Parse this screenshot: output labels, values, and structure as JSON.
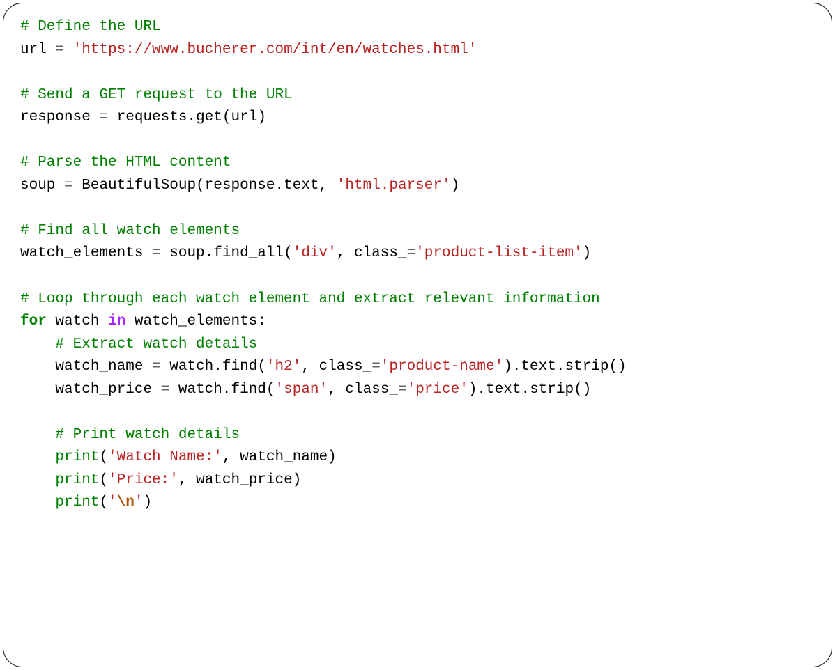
{
  "code": {
    "c1": "# Define the URL",
    "l2_var": "url",
    "l2_eq": " = ",
    "l2_str": "'https://www.bucherer.com/int/en/watches.html'",
    "c3": "# Send a GET request to the URL",
    "l4_var": "response",
    "l4_eq": " = ",
    "l4_call": "requests",
    "l4_dot": ".",
    "l4_get": "get",
    "l4_op": "(",
    "l4_arg": "url",
    "l4_cl": ")",
    "c5": "# Parse the HTML content",
    "l6_var": "soup",
    "l6_eq": " = ",
    "l6_bs": "BeautifulSoup",
    "l6_op": "(",
    "l6_resp": "response",
    "l6_dot": ".",
    "l6_text": "text",
    "l6_comma": ", ",
    "l6_str": "'html.parser'",
    "l6_cl": ")",
    "c7": "# Find all watch elements",
    "l8_var": "watch_elements",
    "l8_eq": " = ",
    "l8_soup": "soup",
    "l8_dot": ".",
    "l8_find": "find_all",
    "l8_op": "(",
    "l8_str1": "'div'",
    "l8_comma": ", ",
    "l8_class": "class_",
    "l8_eq2": "=",
    "l8_str2": "'product-list-item'",
    "l8_cl": ")",
    "c9": "# Loop through each watch element and extract relevant information",
    "l10_for": "for",
    "l10_sp1": " ",
    "l10_watch": "watch",
    "l10_sp2": " ",
    "l10_in": "in",
    "l10_sp3": " ",
    "l10_we": "watch_elements",
    "l10_colon": ":",
    "l11_indent": "    ",
    "c11": "# Extract watch details",
    "l12_indent": "    ",
    "l12_var": "watch_name",
    "l12_eq": " = ",
    "l12_watch": "watch",
    "l12_dot": ".",
    "l12_find": "find",
    "l12_op": "(",
    "l12_str1": "'h2'",
    "l12_comma": ", ",
    "l12_class": "class_",
    "l12_eq2": "=",
    "l12_str2": "'product-name'",
    "l12_cl": ")",
    "l12_dot2": ".",
    "l12_text": "text",
    "l12_dot3": ".",
    "l12_strip": "strip",
    "l12_op2": "(",
    "l12_cl2": ")",
    "l13_indent": "    ",
    "l13_var": "watch_price",
    "l13_eq": " = ",
    "l13_watch": "watch",
    "l13_dot": ".",
    "l13_find": "find",
    "l13_op": "(",
    "l13_str1": "'span'",
    "l13_comma": ", ",
    "l13_class": "class_",
    "l13_eq2": "=",
    "l13_str2": "'price'",
    "l13_cl": ")",
    "l13_dot2": ".",
    "l13_text": "text",
    "l13_dot3": ".",
    "l13_strip": "strip",
    "l13_op2": "(",
    "l13_cl2": ")",
    "l14_indent": "    ",
    "c14": "# Print watch details",
    "l15_indent": "    ",
    "l15_print": "print",
    "l15_op": "(",
    "l15_str": "'Watch Name:'",
    "l15_comma": ", ",
    "l15_var": "watch_name",
    "l15_cl": ")",
    "l16_indent": "    ",
    "l16_print": "print",
    "l16_op": "(",
    "l16_str": "'Price:'",
    "l16_comma": ", ",
    "l16_var": "watch_price",
    "l16_cl": ")",
    "l17_indent": "    ",
    "l17_print": "print",
    "l17_op": "(",
    "l17_q1": "'",
    "l17_esc": "\\n",
    "l17_q2": "'",
    "l17_cl": ")"
  }
}
